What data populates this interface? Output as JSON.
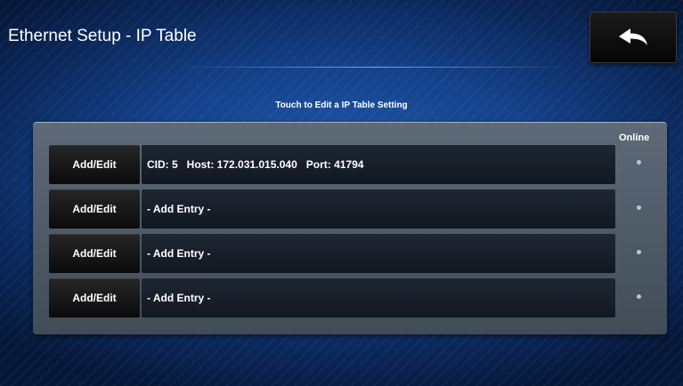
{
  "header": {
    "title": "Ethernet Setup - IP Table",
    "back_icon": "back-arrow-icon"
  },
  "instructions": "Touch to Edit a IP Table Setting",
  "table": {
    "online_header": "Online",
    "rows": [
      {
        "button_label": "Add/Edit",
        "entry": "CID: 5   Host: 172.031.015.040   Port: 41794"
      },
      {
        "button_label": "Add/Edit",
        "entry": "- Add Entry -"
      },
      {
        "button_label": "Add/Edit",
        "entry": "- Add Entry -"
      },
      {
        "button_label": "Add/Edit",
        "entry": "- Add Entry -"
      }
    ]
  },
  "colors": {
    "background": "#14418a",
    "panel": "#5e6a77",
    "entry_field": "#1e2632",
    "button": "#111111",
    "text": "#ffffff",
    "online_dot": "#b9c6d3"
  }
}
